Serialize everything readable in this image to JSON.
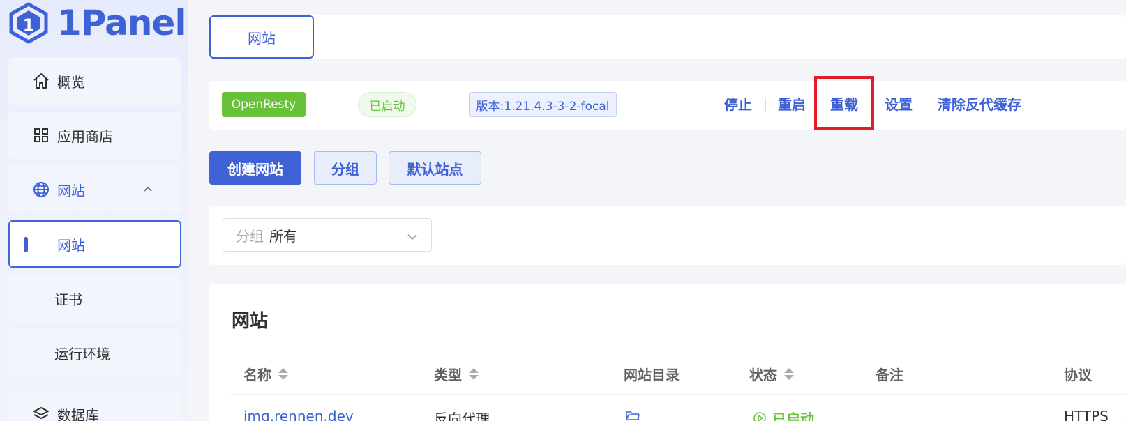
{
  "app": {
    "logo_text": "1Panel"
  },
  "sidebar": {
    "items": [
      {
        "label": "概览",
        "icon": "home-icon"
      },
      {
        "label": "应用商店",
        "icon": "apps-grid-icon"
      },
      {
        "label": "网站",
        "icon": "globe-icon",
        "expanded": true
      },
      {
        "label": "网站",
        "active": true
      },
      {
        "label": "证书"
      },
      {
        "label": "运行环境"
      },
      {
        "label": "数据库",
        "icon": "layers-icon"
      }
    ]
  },
  "tabs": {
    "active_label": "网站"
  },
  "app_status": {
    "name": "OpenResty",
    "state": "已启动",
    "version": "版本:1.21.4.3-3-2-focal",
    "actions": [
      "停止",
      "重启",
      "重载",
      "设置",
      "清除反代缓存"
    ]
  },
  "toolbar": {
    "create_label": "创建网站",
    "group_label": "分组",
    "default_site_label": "默认站点"
  },
  "filter": {
    "prefix": "分组",
    "value": "所有"
  },
  "table": {
    "title": "网站",
    "headers": [
      "名称",
      "类型",
      "网站目录",
      "状态",
      "备注",
      "协议"
    ],
    "rows": [
      {
        "name": "img.rennen.dev",
        "type": "反向代理",
        "status": "已启动",
        "protocol": "HTTPS"
      }
    ]
  },
  "colors": {
    "accent": "#3e62d6",
    "success": "#67c23a",
    "highlight": "#e01e26"
  }
}
